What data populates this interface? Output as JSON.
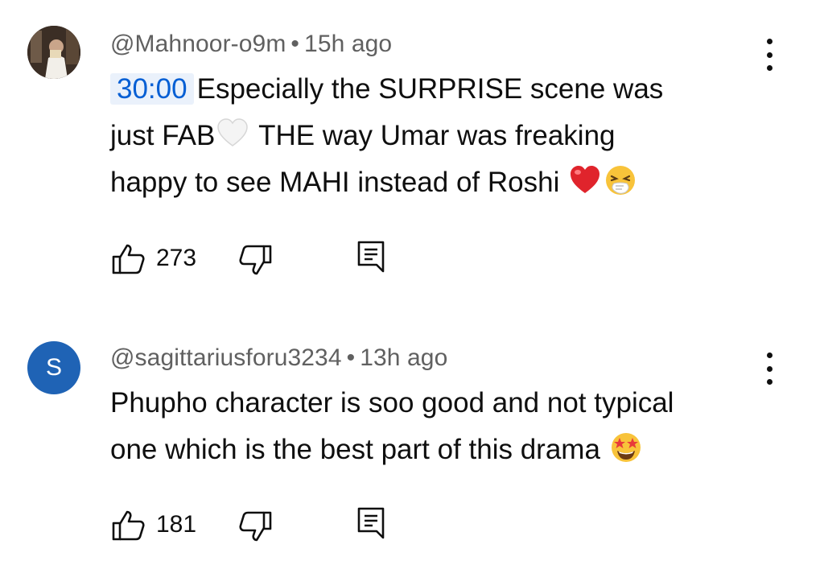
{
  "comments": [
    {
      "handle": "@Mahnoor-o9m",
      "separator": "•",
      "time": "15h ago",
      "timestamp_link": "30:00",
      "line1": "Especially the SURPRISE scene was",
      "line2a": "just FAB",
      "line2b": "THE way Umar was freaking",
      "line3": "happy to see MAHI instead of Roshi",
      "emojis": [
        "white-heart",
        "red-heart",
        "sneezing-face"
      ],
      "likes": "273"
    },
    {
      "handle": "@sagittariusforu3234",
      "separator": "•",
      "time": "13h ago",
      "avatar_letter": "S",
      "line1": "Phupho character is soo good and not typical",
      "line2": "one which is the best part of this drama",
      "emojis": [
        "star-struck"
      ],
      "likes": "181"
    }
  ],
  "colors": {
    "meta_text": "#606060",
    "timestamp_link": "#065fd4",
    "timestamp_bg": "#eaf1fb",
    "avatar_s": "#1f63b5"
  }
}
